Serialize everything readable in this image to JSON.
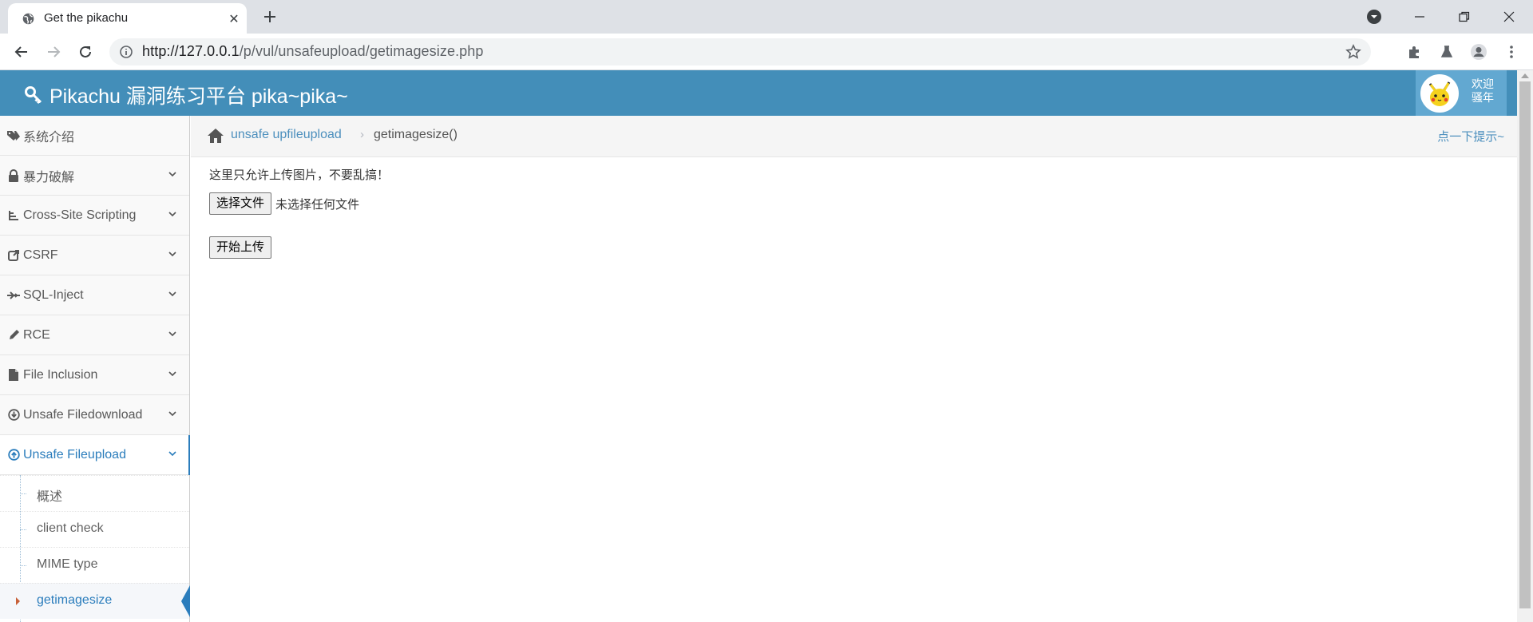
{
  "browser": {
    "tab_title": "Get the pikachu",
    "url_host": "http://127.0.0.1",
    "url_path": "/p/vul/unsafeupload/getimagesize.php"
  },
  "header": {
    "brand": "Pikachu 漏洞练习平台 pika~pika~",
    "user_line1": "欢迎",
    "user_line2": "骚年",
    "bg_color": "#438eb9"
  },
  "sidebar": {
    "items": [
      {
        "label": "系统介绍",
        "icon": "tags-icon"
      },
      {
        "label": "暴力破解",
        "icon": "lock-icon"
      },
      {
        "label": "Cross-Site Scripting",
        "icon": "sitemap-icon"
      },
      {
        "label": "CSRF",
        "icon": "share-square-icon"
      },
      {
        "label": "SQL-Inject",
        "icon": "fighter-jet-icon"
      },
      {
        "label": "RCE",
        "icon": "pencil-icon"
      },
      {
        "label": "File Inclusion",
        "icon": "file-icon"
      },
      {
        "label": "Unsafe Filedownload",
        "icon": "download-circle-icon"
      },
      {
        "label": "Unsafe Fileupload",
        "icon": "upload-circle-icon"
      }
    ],
    "submenu": [
      {
        "label": "概述"
      },
      {
        "label": "client check"
      },
      {
        "label": "MIME type"
      },
      {
        "label": "getimagesize"
      }
    ]
  },
  "breadcrumb": {
    "parent": "unsafe upfileupload",
    "separator": "›",
    "current": "getimagesize()",
    "hint": "点一下提示~"
  },
  "content": {
    "notice": "这里只允许上传图片，不要乱搞！",
    "choose_file_label": "选择文件",
    "file_status": "未选择任何文件",
    "upload_label": "开始上传"
  }
}
